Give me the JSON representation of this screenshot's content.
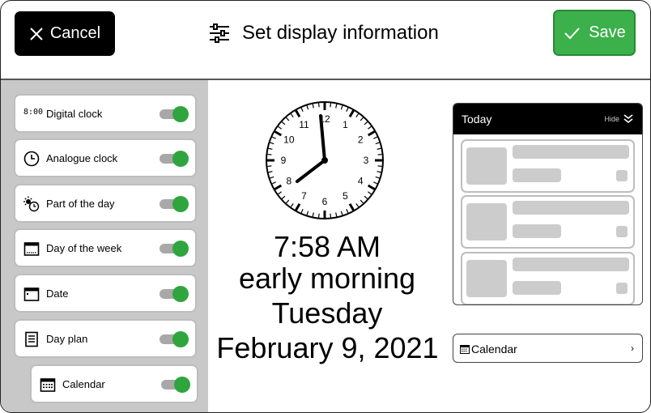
{
  "header": {
    "cancel_label": "Cancel",
    "title": "Set display information",
    "save_label": "Save",
    "accent_color": "#3bb04b"
  },
  "sidebar": {
    "items": [
      {
        "label": "Digital clock",
        "icon": "digital-clock-icon",
        "icon_text": "8:00",
        "enabled": true
      },
      {
        "label": "Analogue clock",
        "icon": "analogue-clock-icon",
        "enabled": true
      },
      {
        "label": "Part of the day",
        "icon": "part-of-day-icon",
        "enabled": true
      },
      {
        "label": "Day of the week",
        "icon": "day-of-week-icon",
        "enabled": true
      },
      {
        "label": "Date",
        "icon": "date-icon",
        "enabled": true
      },
      {
        "label": "Day plan",
        "icon": "day-plan-icon",
        "enabled": true
      },
      {
        "label": "Calendar",
        "icon": "calendar-icon",
        "enabled": true
      }
    ]
  },
  "display": {
    "clock_numbers": [
      "12",
      "1",
      "2",
      "3",
      "4",
      "5",
      "6",
      "7",
      "8",
      "9",
      "10",
      "11"
    ],
    "time": "7:58 AM",
    "part_of_day": "early morning",
    "weekday": "Tuesday",
    "date": "February 9, 2021"
  },
  "preview": {
    "title": "Today",
    "hide_label": "Hide",
    "calendar_label": "Calendar",
    "chevron": "›"
  }
}
